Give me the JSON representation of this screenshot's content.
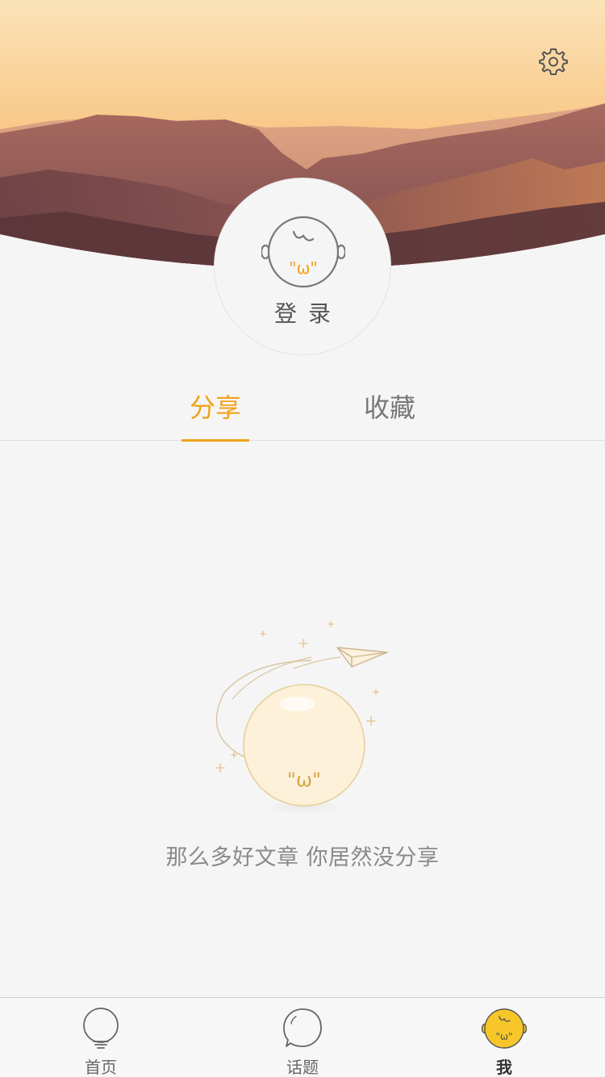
{
  "header": {
    "settings_icon": "gear-icon"
  },
  "profile": {
    "login_label": "登录",
    "avatar_icon": "face-icon",
    "face_text": "\"ω\""
  },
  "tabs": [
    {
      "label": "分享",
      "active": true
    },
    {
      "label": "收藏",
      "active": false
    }
  ],
  "empty_state": {
    "illustration": "moon-paper-plane-icon",
    "face_text": "\"ω\"",
    "message": "那么多好文章 你居然没分享"
  },
  "bottom_nav": [
    {
      "label": "首页",
      "icon": "lightbulb-icon",
      "active": false
    },
    {
      "label": "话题",
      "icon": "speech-bubble-icon",
      "active": false
    },
    {
      "label": "我",
      "icon": "face-icon",
      "active": true,
      "face_text": "\"ω\""
    }
  ],
  "colors": {
    "accent": "#f0a21a",
    "face_yellow": "#f7c72a",
    "background": "#f5f5f5"
  }
}
